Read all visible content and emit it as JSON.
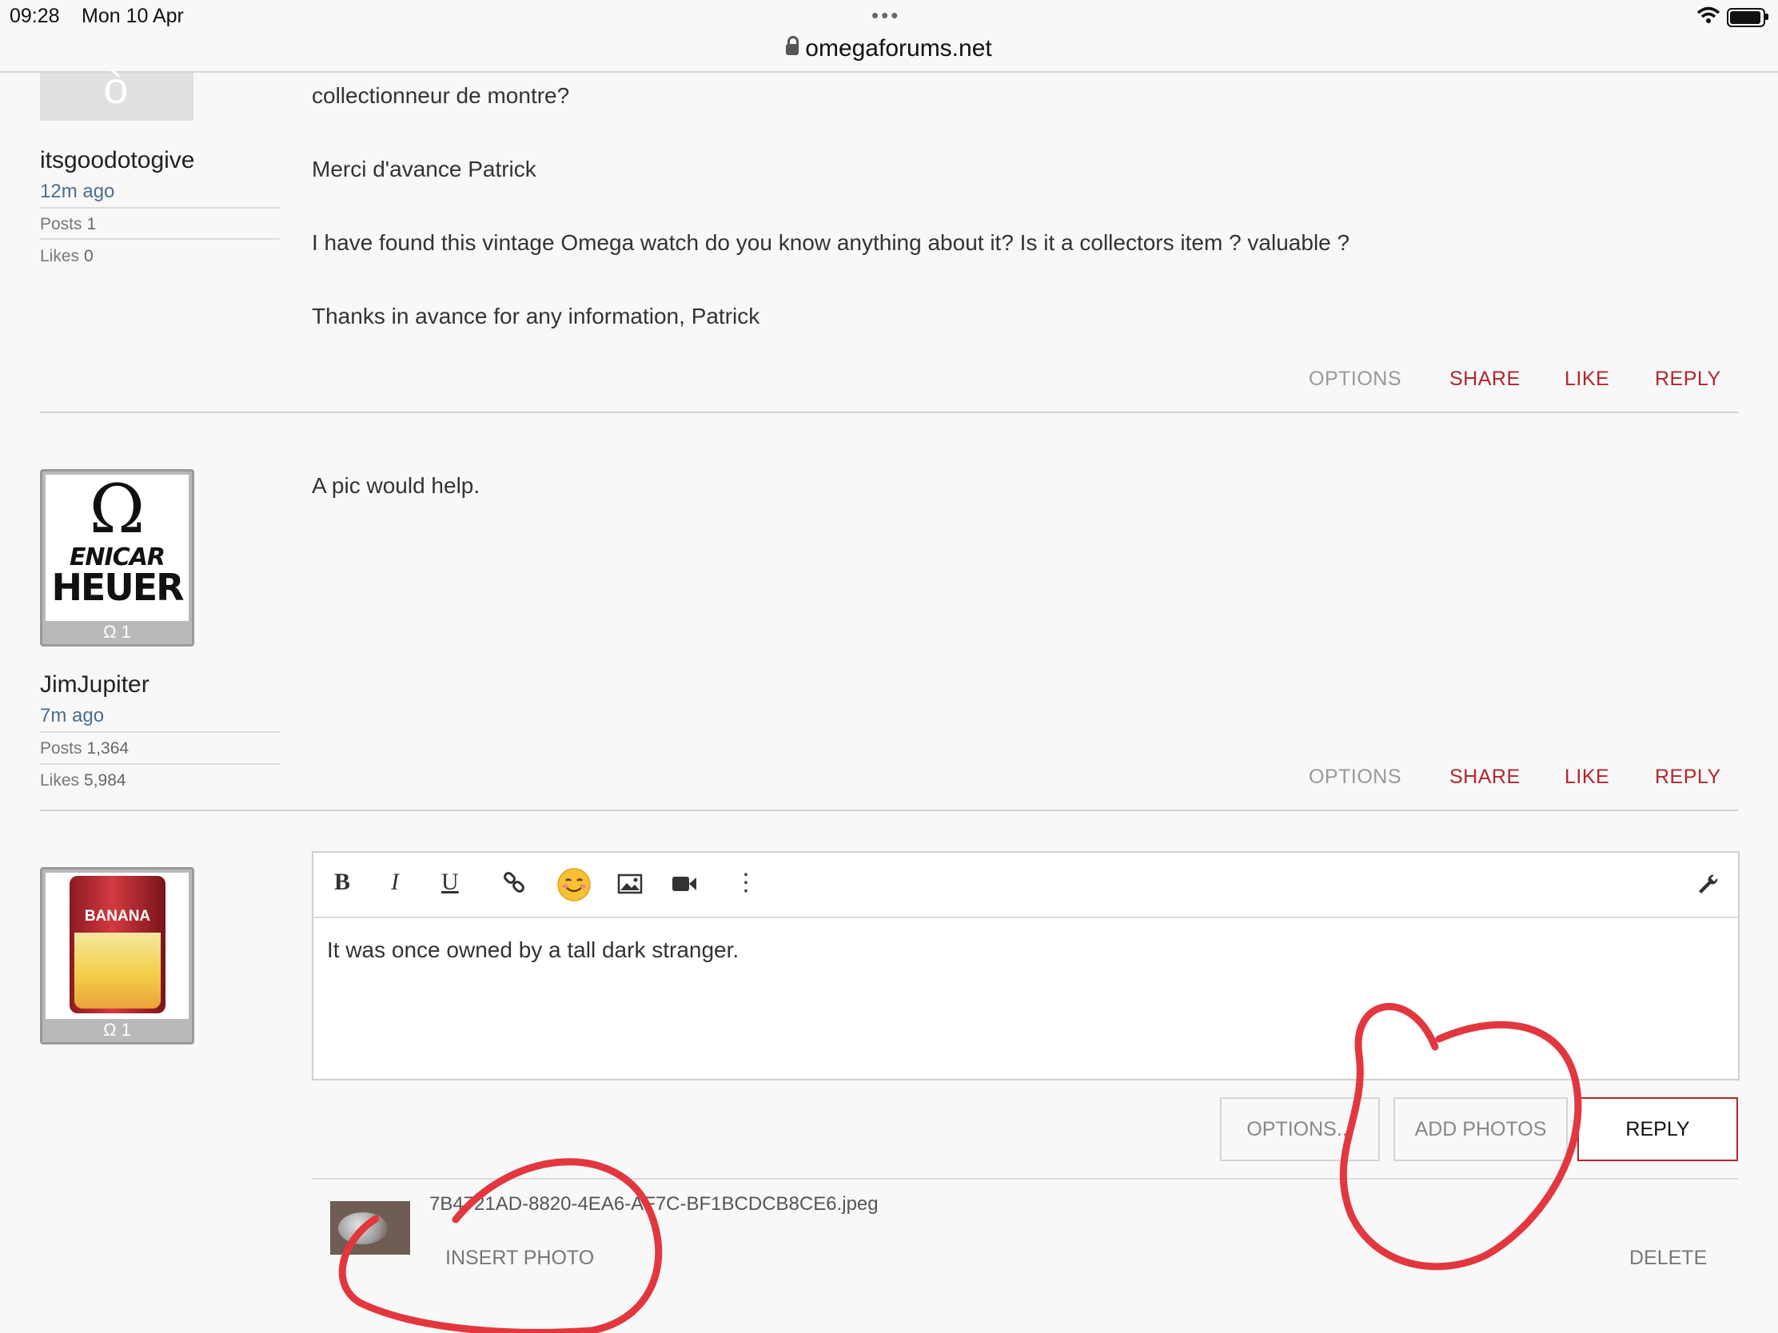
{
  "status_bar": {
    "time": "09:28",
    "date": "Mon 10 Apr",
    "dots": "•••"
  },
  "browser": {
    "url": "omegaforums.net"
  },
  "posts": [
    {
      "user": {
        "name": "itsgoodotogive",
        "ago": "12m ago",
        "posts_label": "Posts",
        "posts": "1",
        "likes_label": "Likes",
        "likes": "0"
      },
      "paragraphs": [
        "collectionneur de montre?",
        "Merci d'avance Patrick",
        "I have found this vintage Omega watch do you know anything about it? Is it a collectors item ? valuable ?",
        "Thanks in avance for any information, Patrick"
      ],
      "actions": {
        "options": "OPTIONS",
        "share": "SHARE",
        "like": "LIKE",
        "reply": "REPLY"
      }
    },
    {
      "user": {
        "name": "JimJupiter",
        "ago": "7m ago",
        "posts_label": "Posts",
        "posts": "1,364",
        "likes_label": "Likes",
        "likes": "5,984",
        "badge": "Ω 1",
        "avatar_text": [
          "ENICAR",
          "HEUER"
        ]
      },
      "paragraphs": [
        "A pic would help."
      ],
      "actions": {
        "options": "OPTIONS",
        "share": "SHARE",
        "like": "LIKE",
        "reply": "REPLY"
      }
    }
  ],
  "composer": {
    "user": {
      "badge": "Ω 1",
      "avatar_text": "BANANA"
    },
    "toolbar": {
      "bold": "B",
      "italic": "I",
      "underline": "U",
      "more": "⋮"
    },
    "text": "It was once owned by a tall dark stranger.",
    "buttons": {
      "options": "OPTIONS...",
      "add_photos": "ADD PHOTOS",
      "reply": "REPLY"
    },
    "attachment": {
      "filename": "7B4721AD-8820-4EA6-AF7C-BF1BCDCB8CE6.jpeg",
      "insert": "INSERT PHOTO",
      "delete": "DELETE"
    }
  },
  "colors": {
    "accent_red": "#b2262b",
    "annotation_red": "#e2373f",
    "link_blue": "#4d6d8f"
  }
}
